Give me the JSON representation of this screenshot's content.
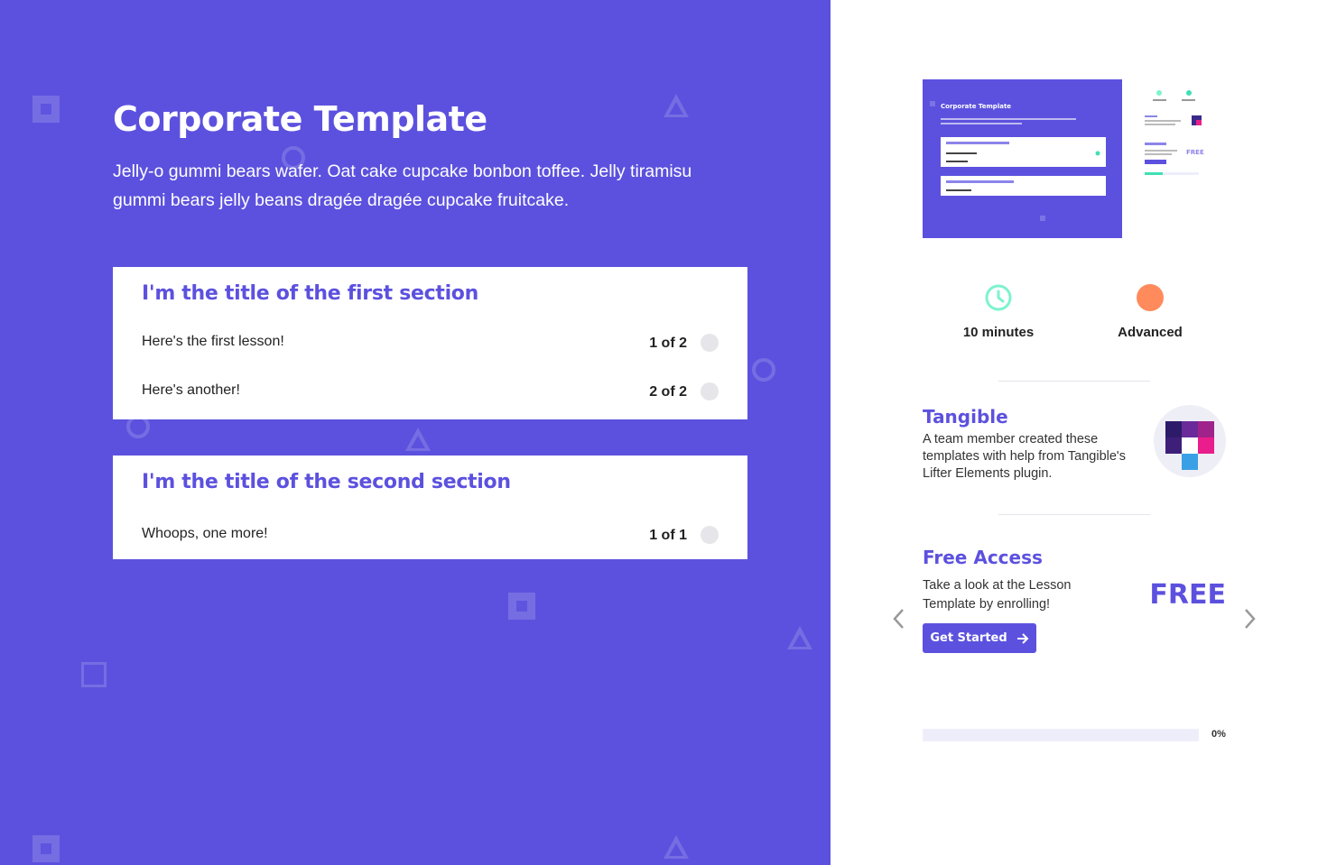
{
  "course": {
    "title": "Corporate Template",
    "description": "Jelly-o gummi bears wafer. Oat cake cupcake bonbon toffee. Jelly tiramisu gummi bears jelly beans dragée dragée cupcake fruitcake."
  },
  "sections": [
    {
      "title": "I'm the title of the first section",
      "lessons": [
        {
          "title": "Here's the first lesson!",
          "count": "1 of 2"
        },
        {
          "title": "Here's another!",
          "count": "2 of 2"
        }
      ]
    },
    {
      "title": "I'm the title of the second section",
      "lessons": [
        {
          "title": "Whoops, one more!",
          "count": "1 of 1"
        }
      ]
    }
  ],
  "meta": {
    "duration": {
      "label": "10 minutes",
      "icon": "clock-icon",
      "color": "#7ef2cf"
    },
    "difficulty": {
      "label": "Advanced",
      "icon": "difficulty-dot-icon",
      "color": "#ff8a5c"
    }
  },
  "author": {
    "name": "Tangible",
    "bio": "A team member created these templates with help from Tangible's Lifter Elements plugin.",
    "logo_icon": "tangible-logo"
  },
  "access": {
    "title": "Free Access",
    "description": "Take a look at the Lesson Template by enrolling!",
    "price": "FREE",
    "button_label": "Get Started"
  },
  "progress": {
    "value": 0,
    "label": "0%"
  },
  "thumbnail": {
    "title": "Corporate Template",
    "side_free": "FREE"
  },
  "colors": {
    "brand": "#5c51de",
    "accent": "#3fe0b4",
    "orange": "#ff8a5c"
  }
}
